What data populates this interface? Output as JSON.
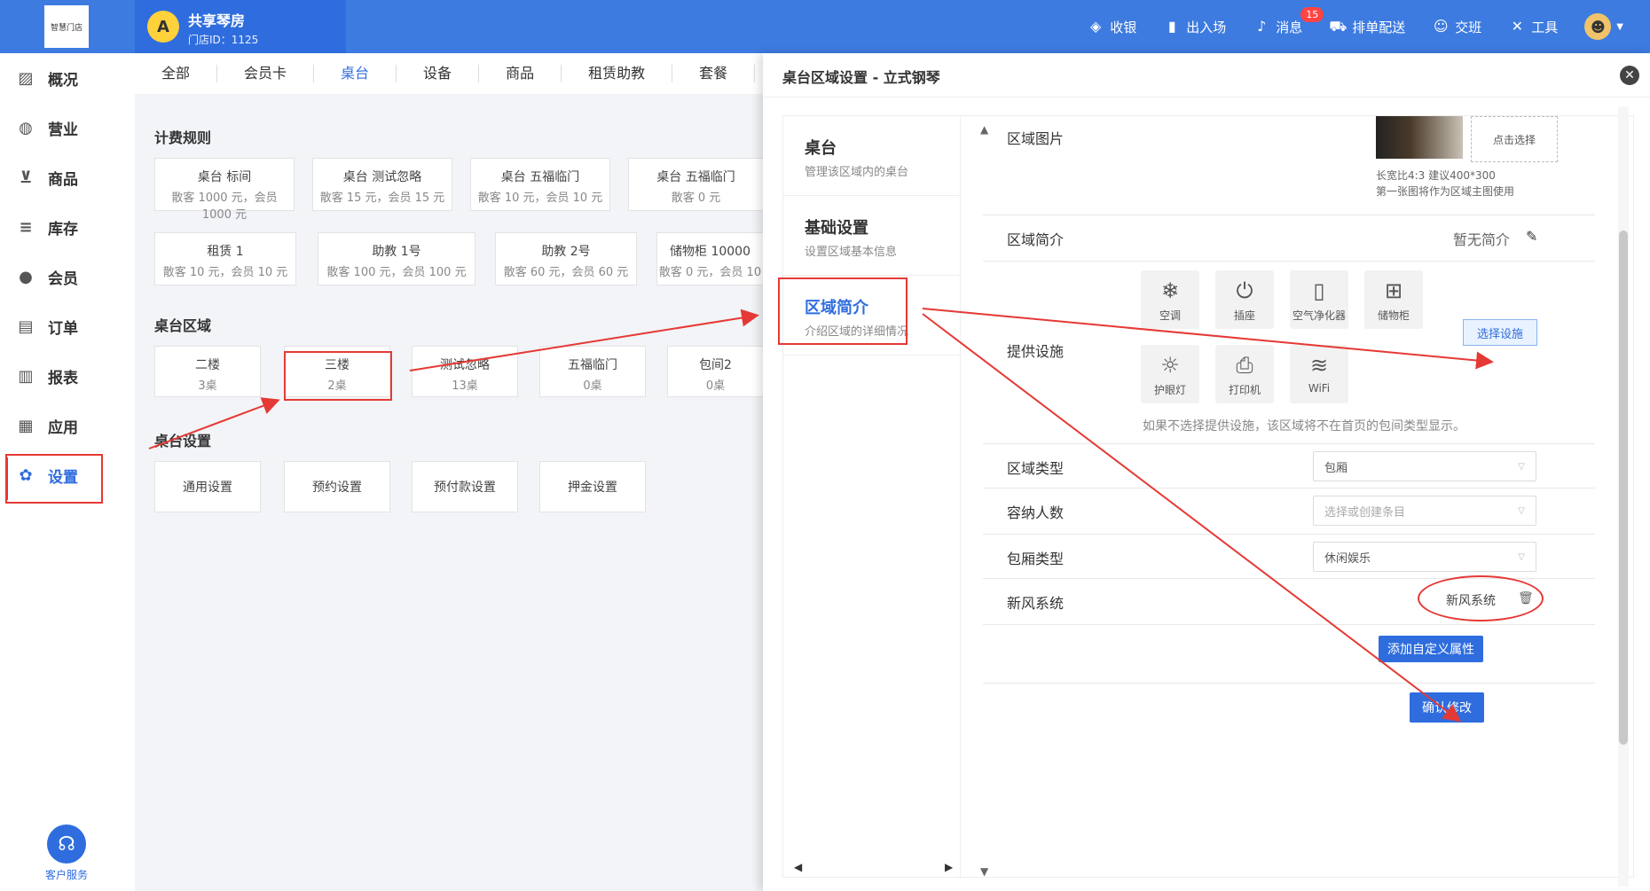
{
  "topbar": {
    "logo_text": "智慧门店",
    "store_name": "共享琴房",
    "store_id": "门店ID：1125",
    "menu": [
      {
        "label": "收银",
        "icon": "cashier-icon"
      },
      {
        "label": "出入场",
        "icon": "door-icon"
      },
      {
        "label": "消息",
        "icon": "bell-icon",
        "badge": "15"
      },
      {
        "label": "排单配送",
        "icon": "delivery-icon"
      },
      {
        "label": "交班",
        "icon": "handover-icon"
      },
      {
        "label": "工具",
        "icon": "tools-icon"
      }
    ]
  },
  "sidebar": {
    "items": [
      {
        "label": "概况",
        "icon": "chart-icon"
      },
      {
        "label": "营业",
        "icon": "money-bag-icon"
      },
      {
        "label": "商品",
        "icon": "cart-icon"
      },
      {
        "label": "库存",
        "icon": "layers-icon"
      },
      {
        "label": "会员",
        "icon": "user-icon"
      },
      {
        "label": "订单",
        "icon": "order-icon"
      },
      {
        "label": "报表",
        "icon": "bar-chart-icon"
      },
      {
        "label": "应用",
        "icon": "apps-icon"
      },
      {
        "label": "设置",
        "icon": "gear-icon"
      }
    ],
    "service": "客户服务"
  },
  "tabs": [
    "全部",
    "会员卡",
    "桌台",
    "设备",
    "商品",
    "租赁助教",
    "套餐"
  ],
  "billing": {
    "title": "计费规则",
    "cards": [
      {
        "title": "桌台 标间",
        "sub": "散客 1000 元，会员 1000 元"
      },
      {
        "title": "桌台 测试忽略",
        "sub": "散客 15 元，会员 15 元"
      },
      {
        "title": "桌台 五福临门",
        "sub": "散客 10 元，会员 10 元"
      },
      {
        "title": "桌台 五福临门",
        "sub": "散客 0 元"
      },
      {
        "title": "租赁 1",
        "sub": "散客 10 元，会员 10 元"
      },
      {
        "title": "助教 1号",
        "sub": "散客 100 元，会员 100 元"
      },
      {
        "title": "助教 2号",
        "sub": "散客 60 元，会员 60 元"
      },
      {
        "title": "储物柜 10000",
        "sub": "散客 0 元，会员 10"
      }
    ]
  },
  "areas": {
    "title": "桌台区域",
    "cards": [
      {
        "title": "二楼",
        "sub": "3桌"
      },
      {
        "title": "三楼",
        "sub": "2桌"
      },
      {
        "title": "测试忽略",
        "sub": "13桌"
      },
      {
        "title": "五福临门",
        "sub": "0桌"
      },
      {
        "title": "包间2",
        "sub": "0桌"
      }
    ]
  },
  "table_settings": {
    "title": "桌台设置",
    "cards": [
      "通用设置",
      "预约设置",
      "预付款设置",
      "押金设置"
    ]
  },
  "modal": {
    "title": "桌台区域设置 - 立式钢琴",
    "subnav": [
      {
        "title": "桌台",
        "desc": "管理该区域内的桌台"
      },
      {
        "title": "基础设置",
        "desc": "设置区域基本信息"
      },
      {
        "title": "区域简介",
        "desc": "介绍区域的详细情况"
      }
    ],
    "area_image": {
      "label": "区域图片",
      "upload": "点击选择",
      "hint1": "长宽比4:3 建议400*300",
      "hint2": "第一张图将作为区域主图使用"
    },
    "intro": {
      "label": "区域简介",
      "value": "暂无简介"
    },
    "facilities": {
      "label": "提供设施",
      "items": [
        {
          "label": "空调",
          "icon": "snowflake-icon",
          "glyph": "❄"
        },
        {
          "label": "插座",
          "icon": "socket-icon",
          "glyph": "⏻"
        },
        {
          "label": "空气净化器",
          "icon": "air-purifier-icon",
          "glyph": "▯"
        },
        {
          "label": "储物柜",
          "icon": "locker-icon",
          "glyph": "⊞"
        },
        {
          "label": "护眼灯",
          "icon": "lamp-icon",
          "glyph": "☼"
        },
        {
          "label": "打印机",
          "icon": "printer-icon",
          "glyph": "⎙"
        },
        {
          "label": "WiFi",
          "icon": "wifi-icon",
          "glyph": "≋"
        }
      ],
      "select_button": "选择设施",
      "hint": "如果不选择提供设施，该区域将不在首页的包间类型显示。"
    },
    "area_type": {
      "label": "区域类型",
      "value": "包厢"
    },
    "capacity": {
      "label": "容纳人数",
      "placeholder": "选择或创建条目"
    },
    "room_type": {
      "label": "包厢类型",
      "value": "休闲娱乐"
    },
    "custom_prop": {
      "label": "新风系统",
      "value": "新风系统"
    },
    "add_custom_button": "添加自定义属性",
    "confirm_button": "确认修改"
  },
  "colors": {
    "primary": "#2f6dde",
    "annotation": "#e53935"
  }
}
